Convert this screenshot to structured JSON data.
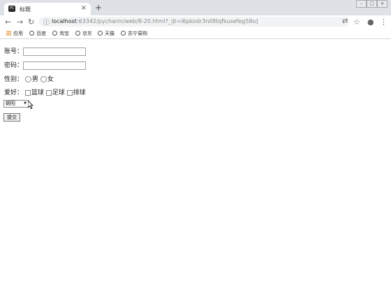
{
  "browser": {
    "tab_title": "标题",
    "tab_favicon_text": "PC",
    "close_glyph": "×",
    "newtab_glyph": "+",
    "url_host": "localhost",
    "url_rest": ":63342/pycharm/web/8-20.html?_ijt=l6pkodr3nll8tqfkusefeg58o]",
    "window_controls": [
      "–",
      "▢",
      "×"
    ],
    "bookmarks": [
      "应用",
      "百度",
      "淘宝",
      "京东",
      "天猫",
      "苏宁易购"
    ]
  },
  "form": {
    "account_label": "账号：",
    "password_label": "密码：",
    "gender_label": "性别：",
    "gender_options": [
      "男",
      "女"
    ],
    "hobby_label": "爱好：",
    "hobby_options": [
      "篮球",
      "足球",
      "排球"
    ],
    "city_selected": "朝阳",
    "submit_label": "提交"
  }
}
